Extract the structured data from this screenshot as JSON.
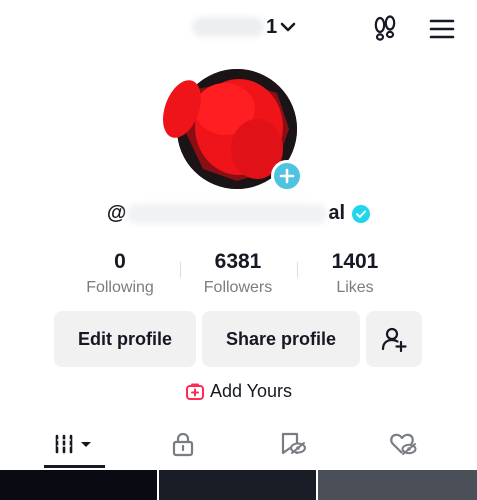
{
  "header": {
    "username_tail": "1",
    "footprints_icon": "footprints-icon",
    "menu_icon": "hamburger-menu-icon"
  },
  "profile": {
    "handle_prefix": "@",
    "handle_tail": "al",
    "verified_icon": "verified-badge-icon",
    "add_avatar_icon": "plus-icon"
  },
  "stats": {
    "following": {
      "count": "0",
      "label": "Following"
    },
    "followers": {
      "count": "6381",
      "label": "Followers"
    },
    "likes": {
      "count": "1401",
      "label": "Likes"
    }
  },
  "actions": {
    "edit_label": "Edit profile",
    "share_label": "Share profile",
    "add_friend_icon": "add-user-icon"
  },
  "add_yours": {
    "label": "Add Yours",
    "icon": "add-yours-icon"
  },
  "tabs": [
    {
      "name": "videos",
      "icon": "grid-icon"
    },
    {
      "name": "private",
      "icon": "lock-icon"
    },
    {
      "name": "reposts",
      "icon": "repost-icon"
    },
    {
      "name": "liked",
      "icon": "liked-icon"
    }
  ],
  "colors": {
    "accent_blue": "#4ec3df",
    "verified_blue": "#20d5ec",
    "add_yours_red": "#fe2c55",
    "button_bg": "#f1f1f2",
    "text_primary": "#161823",
    "text_secondary": "#7a7c84"
  }
}
